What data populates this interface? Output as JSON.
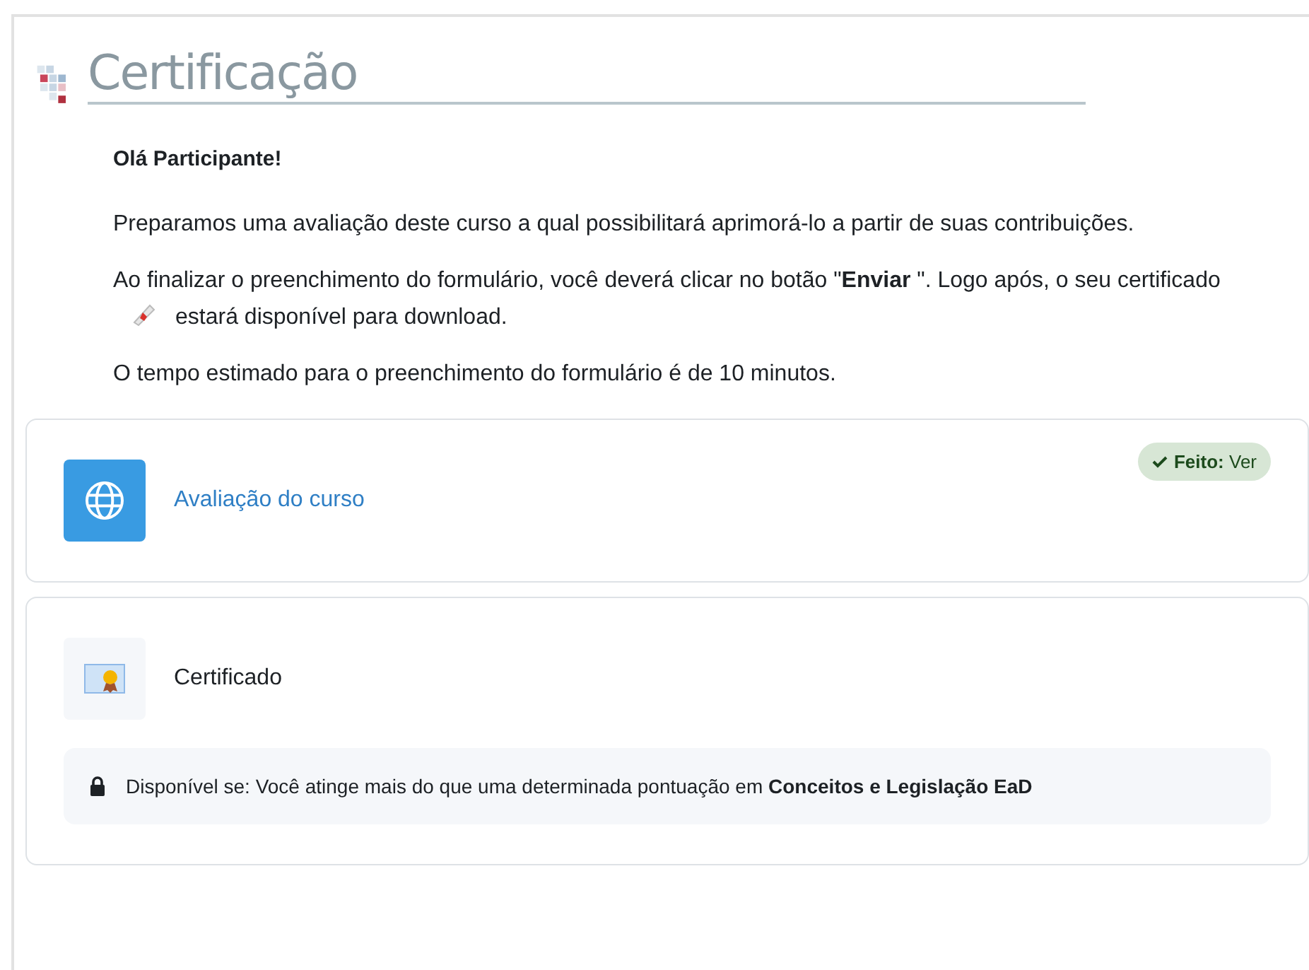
{
  "title": "Certificação",
  "greeting": "Olá Participante!",
  "paragraphs": [
    {
      "kind": "text",
      "text": "Preparamos uma avaliação deste curso a qual possibilitará aprimorá-lo a partir de suas contribuições."
    },
    {
      "kind": "with_icon",
      "before": "Ao finalizar o preenchimento do formulário, você deverá clicar no botão \"**Enviar** \".  Logo após, o seu certificado",
      "after": "estará disponível para download."
    },
    {
      "kind": "text",
      "text": "O tempo estimado para o preenchimento do formulário é de 10 minutos."
    }
  ],
  "activities": [
    {
      "kind": "feedback",
      "name": "Avaliação do curso",
      "link": true,
      "completion": "**Feito:** Ver",
      "done": true
    },
    {
      "kind": "certificate",
      "name": "Certificado",
      "link": false,
      "restriction": "Disponível se: Você atinge mais do que uma determinada pontuação em **Conceitos e Legislação EaD**"
    }
  ]
}
